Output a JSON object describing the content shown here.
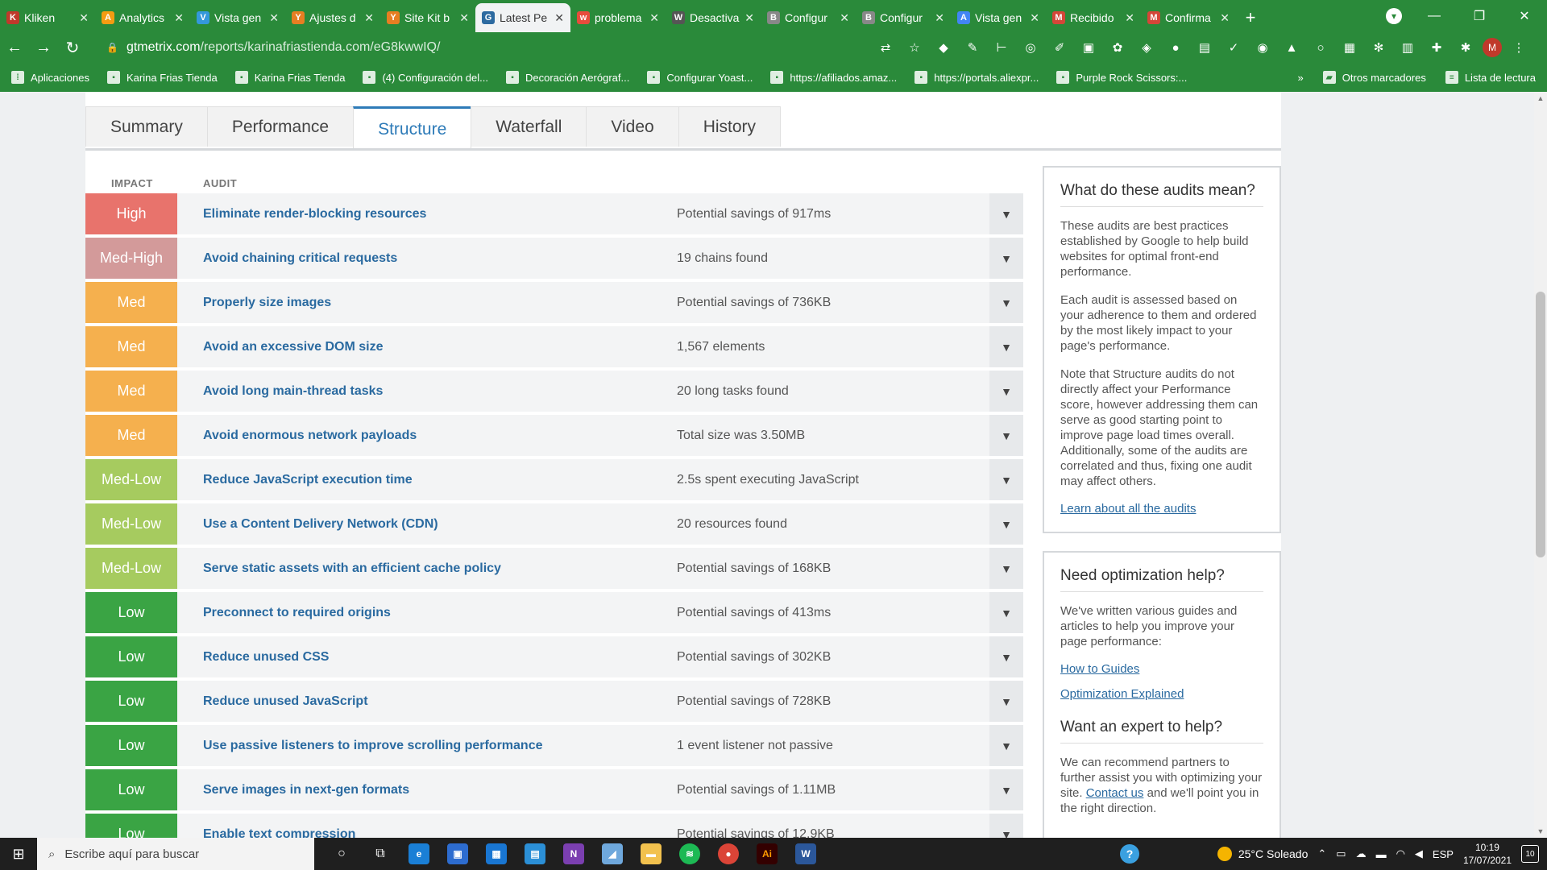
{
  "browser": {
    "tabs": [
      {
        "label": "Kliken",
        "color": "#c0392b",
        "glyph": "K"
      },
      {
        "label": "Analytics",
        "color": "#f39c12",
        "glyph": "A"
      },
      {
        "label": "Vista gen",
        "color": "#3498db",
        "glyph": "V"
      },
      {
        "label": "Ajustes d",
        "color": "#e67e22",
        "glyph": "Y"
      },
      {
        "label": "Site Kit b",
        "color": "#e67e22",
        "glyph": "Y"
      },
      {
        "label": "Latest Pe",
        "color": "#2c6aa0",
        "glyph": "G"
      },
      {
        "label": "problema",
        "color": "#e74c3c",
        "glyph": "w"
      },
      {
        "label": "Desactiva",
        "color": "#555555",
        "glyph": "W"
      },
      {
        "label": "Configur",
        "color": "#888888",
        "glyph": "B"
      },
      {
        "label": "Configur",
        "color": "#888888",
        "glyph": "B"
      },
      {
        "label": "Vista gen",
        "color": "#4285f4",
        "glyph": "A"
      },
      {
        "label": "Recibido",
        "color": "#d44638",
        "glyph": "M"
      },
      {
        "label": "Confirma",
        "color": "#d44638",
        "glyph": "M"
      }
    ],
    "active_tab_index": 5,
    "url_host": "gtmetrix.com",
    "url_path": "/reports/karinafriastienda.com/eG8kwwIQ/",
    "profile_initial": "M"
  },
  "bookmarks": {
    "items": [
      "Aplicaciones",
      "Karina Frias Tienda",
      "Karina Frias Tienda",
      "(4) Configuración del...",
      "Decoración Aerógraf...",
      "Configurar Yoast...",
      "https://afiliados.amaz...",
      "https://portals.aliexpr...",
      "Purple Rock Scissors:..."
    ],
    "overflow": "»",
    "other": "Otros marcadores",
    "reading_list": "Lista de lectura"
  },
  "report": {
    "tabs": [
      "Summary",
      "Performance",
      "Structure",
      "Waterfall",
      "Video",
      "History"
    ],
    "active_tab": "Structure",
    "col_impact": "IMPACT",
    "col_audit": "AUDIT",
    "audits": [
      {
        "impact": "High",
        "title": "Eliminate render-blocking resources",
        "value": "Potential savings of 917ms"
      },
      {
        "impact": "Med-High",
        "title": "Avoid chaining critical requests",
        "value": "19 chains found"
      },
      {
        "impact": "Med",
        "title": "Properly size images",
        "value": "Potential savings of 736KB"
      },
      {
        "impact": "Med",
        "title": "Avoid an excessive DOM size",
        "value": "1,567 elements"
      },
      {
        "impact": "Med",
        "title": "Avoid long main-thread tasks",
        "value": "20 long tasks found"
      },
      {
        "impact": "Med",
        "title": "Avoid enormous network payloads",
        "value": "Total size was 3.50MB"
      },
      {
        "impact": "Med-Low",
        "title": "Reduce JavaScript execution time",
        "value": "2.5s spent executing JavaScript"
      },
      {
        "impact": "Med-Low",
        "title": "Use a Content Delivery Network (CDN)",
        "value": "20 resources found"
      },
      {
        "impact": "Med-Low",
        "title": "Serve static assets with an efficient cache policy",
        "value": "Potential savings of 168KB"
      },
      {
        "impact": "Low",
        "title": "Preconnect to required origins",
        "value": "Potential savings of 413ms"
      },
      {
        "impact": "Low",
        "title": "Reduce unused CSS",
        "value": "Potential savings of 302KB"
      },
      {
        "impact": "Low",
        "title": "Reduce unused JavaScript",
        "value": "Potential savings of 728KB"
      },
      {
        "impact": "Low",
        "title": "Use passive listeners to improve scrolling performance",
        "value": "1 event listener not passive"
      },
      {
        "impact": "Low",
        "title": "Serve images in next-gen formats",
        "value": "Potential savings of 1.11MB"
      },
      {
        "impact": "Low",
        "title": "Enable text compression",
        "value": "Potential savings of 12.9KB"
      }
    ],
    "impact_colors": {
      "High": "#e8736c",
      "Med-High": "#d39a9a",
      "Med": "#f5b04e",
      "Med-Low": "#a6cb5f",
      "Low": "#3aa444"
    }
  },
  "sidebar": {
    "box1": {
      "heading": "What do these audits mean?",
      "p1": "These audits are best practices established by Google to help build websites for optimal front-end performance.",
      "p2": "Each audit is assessed based on your adherence to them and ordered by the most likely impact to your page's performance.",
      "p3": "Note that Structure audits do not directly affect your Performance score, however addressing them can serve as good starting point to improve page load times overall. Additionally, some of the audits are correlated and thus, fixing one audit may affect others.",
      "link": "Learn about all the audits"
    },
    "box2": {
      "heading": "Need optimization help?",
      "p1": "We've written various guides and articles to help you improve your page performance:",
      "link1": "How to Guides",
      "link2": "Optimization Explained",
      "heading2": "Want an expert to help?",
      "p2_before": "We can recommend partners to further assist you with optimizing your site.",
      "p2_link": "Contact us",
      "p2_after": "and we'll point you in the right direction."
    }
  },
  "taskbar": {
    "search_placeholder": "Escribe aquí para buscar",
    "weather": "25°C Soleado",
    "lang": "ESP",
    "time": "10:19",
    "date": "17/07/2021",
    "notifications": "10"
  }
}
